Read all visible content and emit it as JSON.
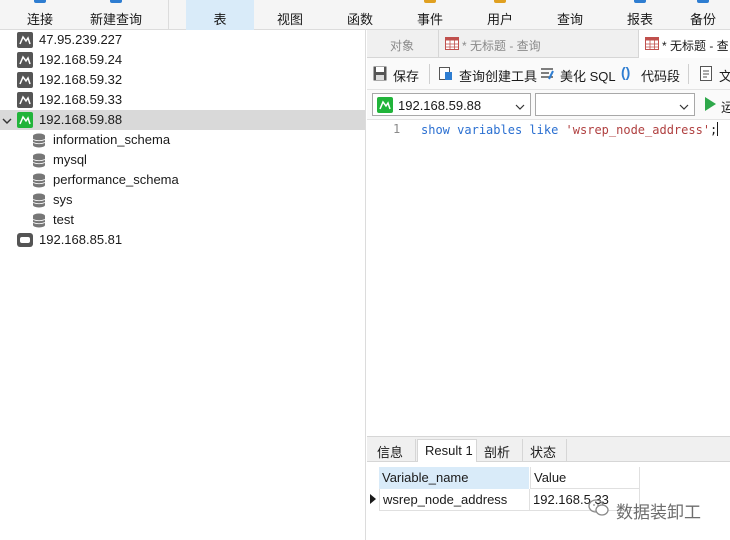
{
  "ribbon": {
    "buttons": [
      {
        "label": "连接",
        "icon": "connect-icon",
        "color": "#2e7dd1"
      },
      {
        "label": "新建查询",
        "icon": "new-query-icon",
        "color": "#2e7dd1"
      },
      {
        "label": "表",
        "icon": "table-icon",
        "color": "#2e7dd1",
        "active": true
      },
      {
        "label": "视图",
        "icon": "view-icon",
        "color": "#2e7dd1"
      },
      {
        "label": "函数",
        "icon": "function-icon",
        "color": "#2e7dd1"
      },
      {
        "label": "事件",
        "icon": "event-icon",
        "color": "#e0a020"
      },
      {
        "label": "用户",
        "icon": "user-icon",
        "color": "#e0a020"
      },
      {
        "label": "查询",
        "icon": "query-icon",
        "color": "#2e7dd1"
      },
      {
        "label": "报表",
        "icon": "report-icon",
        "color": "#2e7dd1"
      },
      {
        "label": "备份",
        "icon": "backup-icon",
        "color": "#2e7dd1"
      }
    ]
  },
  "tree": {
    "connections": [
      {
        "label": "47.95.239.227",
        "icon": "mysql-connection-icon"
      },
      {
        "label": "192.168.59.24",
        "icon": "mysql-connection-icon"
      },
      {
        "label": "192.168.59.32",
        "icon": "mysql-connection-icon"
      },
      {
        "label": "192.168.59.33",
        "icon": "mysql-connection-icon"
      },
      {
        "label": "192.168.59.88",
        "icon": "mysql-connection-open-icon",
        "expanded": true,
        "selected": true
      }
    ],
    "databases": [
      "information_schema",
      "mysql",
      "performance_schema",
      "sys",
      "test"
    ],
    "last_connection": {
      "label": "192.168.85.81",
      "icon": "generic-connection-icon"
    }
  },
  "tabs": {
    "objects": "对象",
    "query_tab_1": "* 无标题 - 查询",
    "query_tab_2": "* 无标题 - 查"
  },
  "toolbar": {
    "save": "保存",
    "query_builder": "查询创建工具",
    "beautify": "美化 SQL",
    "snippet": "代码段",
    "text": "文"
  },
  "connection_select": {
    "connection": "192.168.59.88",
    "database": "",
    "run": "运"
  },
  "editor": {
    "line_number": "1",
    "tokens": {
      "kw1": "show",
      "kw2": "variables",
      "kw3": "like",
      "str": "'wsrep_node_address'",
      "end": ";"
    }
  },
  "result_tabs": [
    "信息",
    "Result 1",
    "剖析",
    "状态"
  ],
  "result": {
    "columns": [
      "Variable_name",
      "Value"
    ],
    "rows": [
      [
        "wsrep_node_address",
        "192.168.59.33"
      ]
    ],
    "value_visible": "192.168.5  33"
  },
  "watermark": {
    "text": "数据装卸工"
  },
  "colors": {
    "mysql_green": "#21b43a",
    "selection_blue": "#d9ebf9",
    "keyword": "#2a6fd1",
    "string": "#b04040"
  }
}
